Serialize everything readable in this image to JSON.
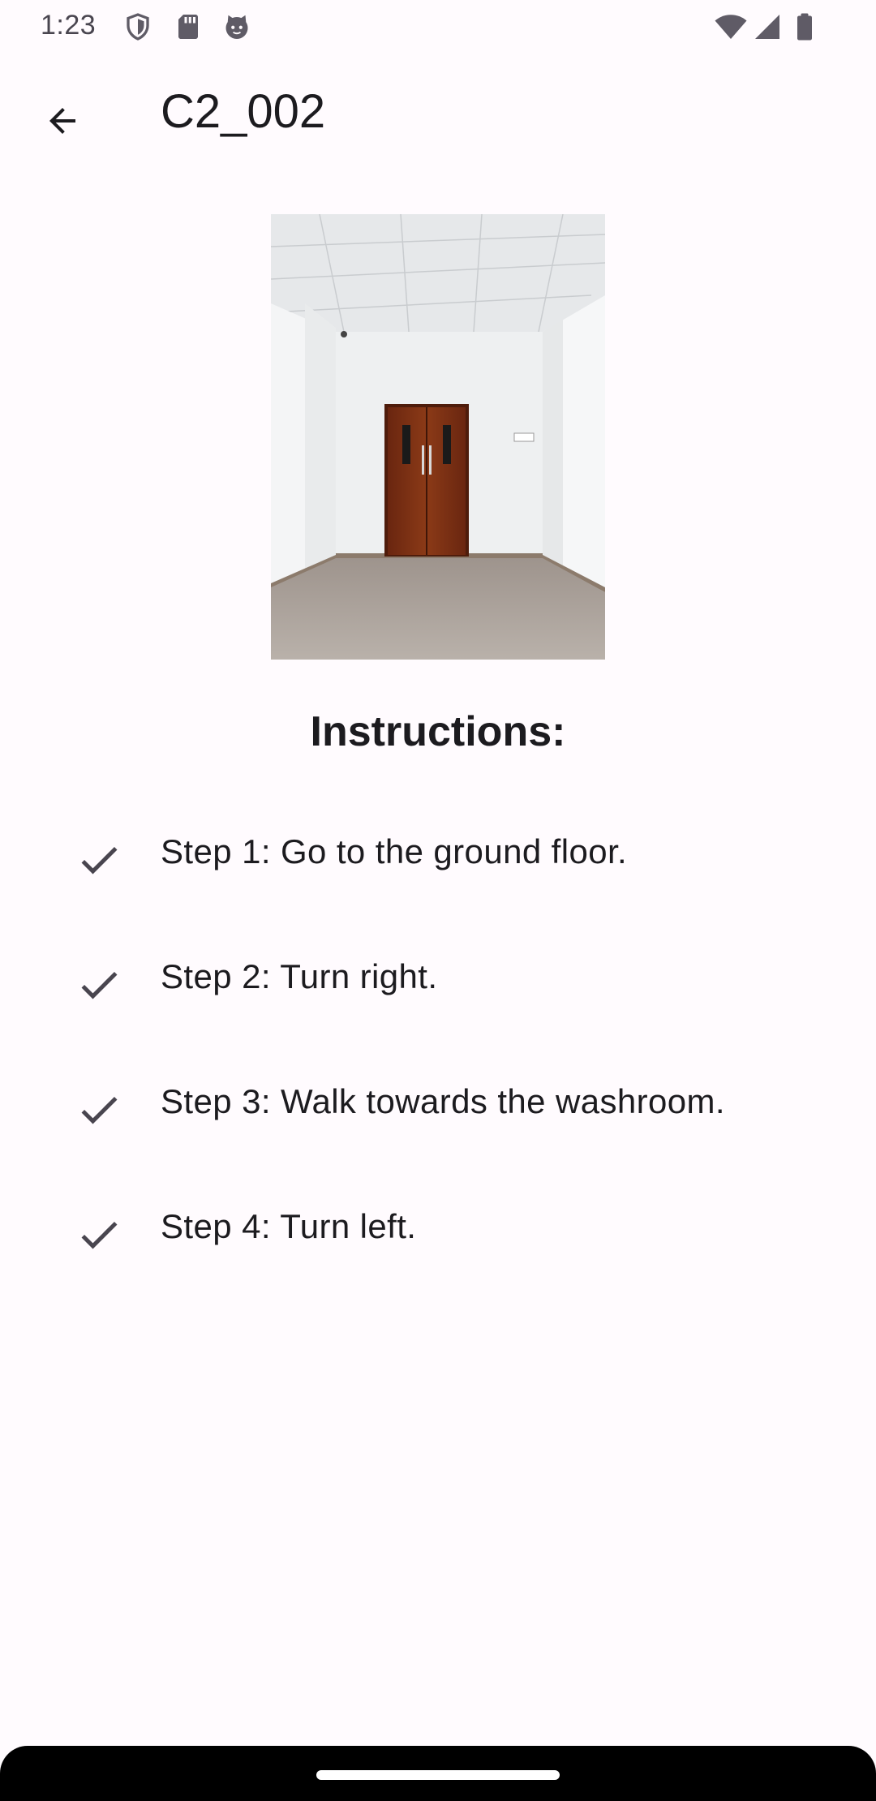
{
  "status_bar": {
    "time": "1:23",
    "left_icons": [
      "shield-icon",
      "sd-card-icon",
      "cat-face-icon"
    ],
    "right_icons": [
      "wifi-icon",
      "cell-signal-icon",
      "battery-icon"
    ]
  },
  "app_bar": {
    "back_icon": "arrow-back-icon",
    "title": "C2_002"
  },
  "image": {
    "subject": "corridor-with-wooden-double-door"
  },
  "instructions": {
    "heading": "Instructions:",
    "steps": [
      {
        "icon": "check-icon",
        "text": "Step 1: Go to the ground floor."
      },
      {
        "icon": "check-icon",
        "text": "Step 2: Turn right."
      },
      {
        "icon": "check-icon",
        "text": "Step 3: Walk towards the washroom."
      },
      {
        "icon": "check-icon",
        "text": "Step 4: Turn left."
      }
    ]
  },
  "colors": {
    "background": "#FFFBFE",
    "text": "#1C1B1F",
    "icon": "#49454F",
    "door": "#7A2E12"
  }
}
